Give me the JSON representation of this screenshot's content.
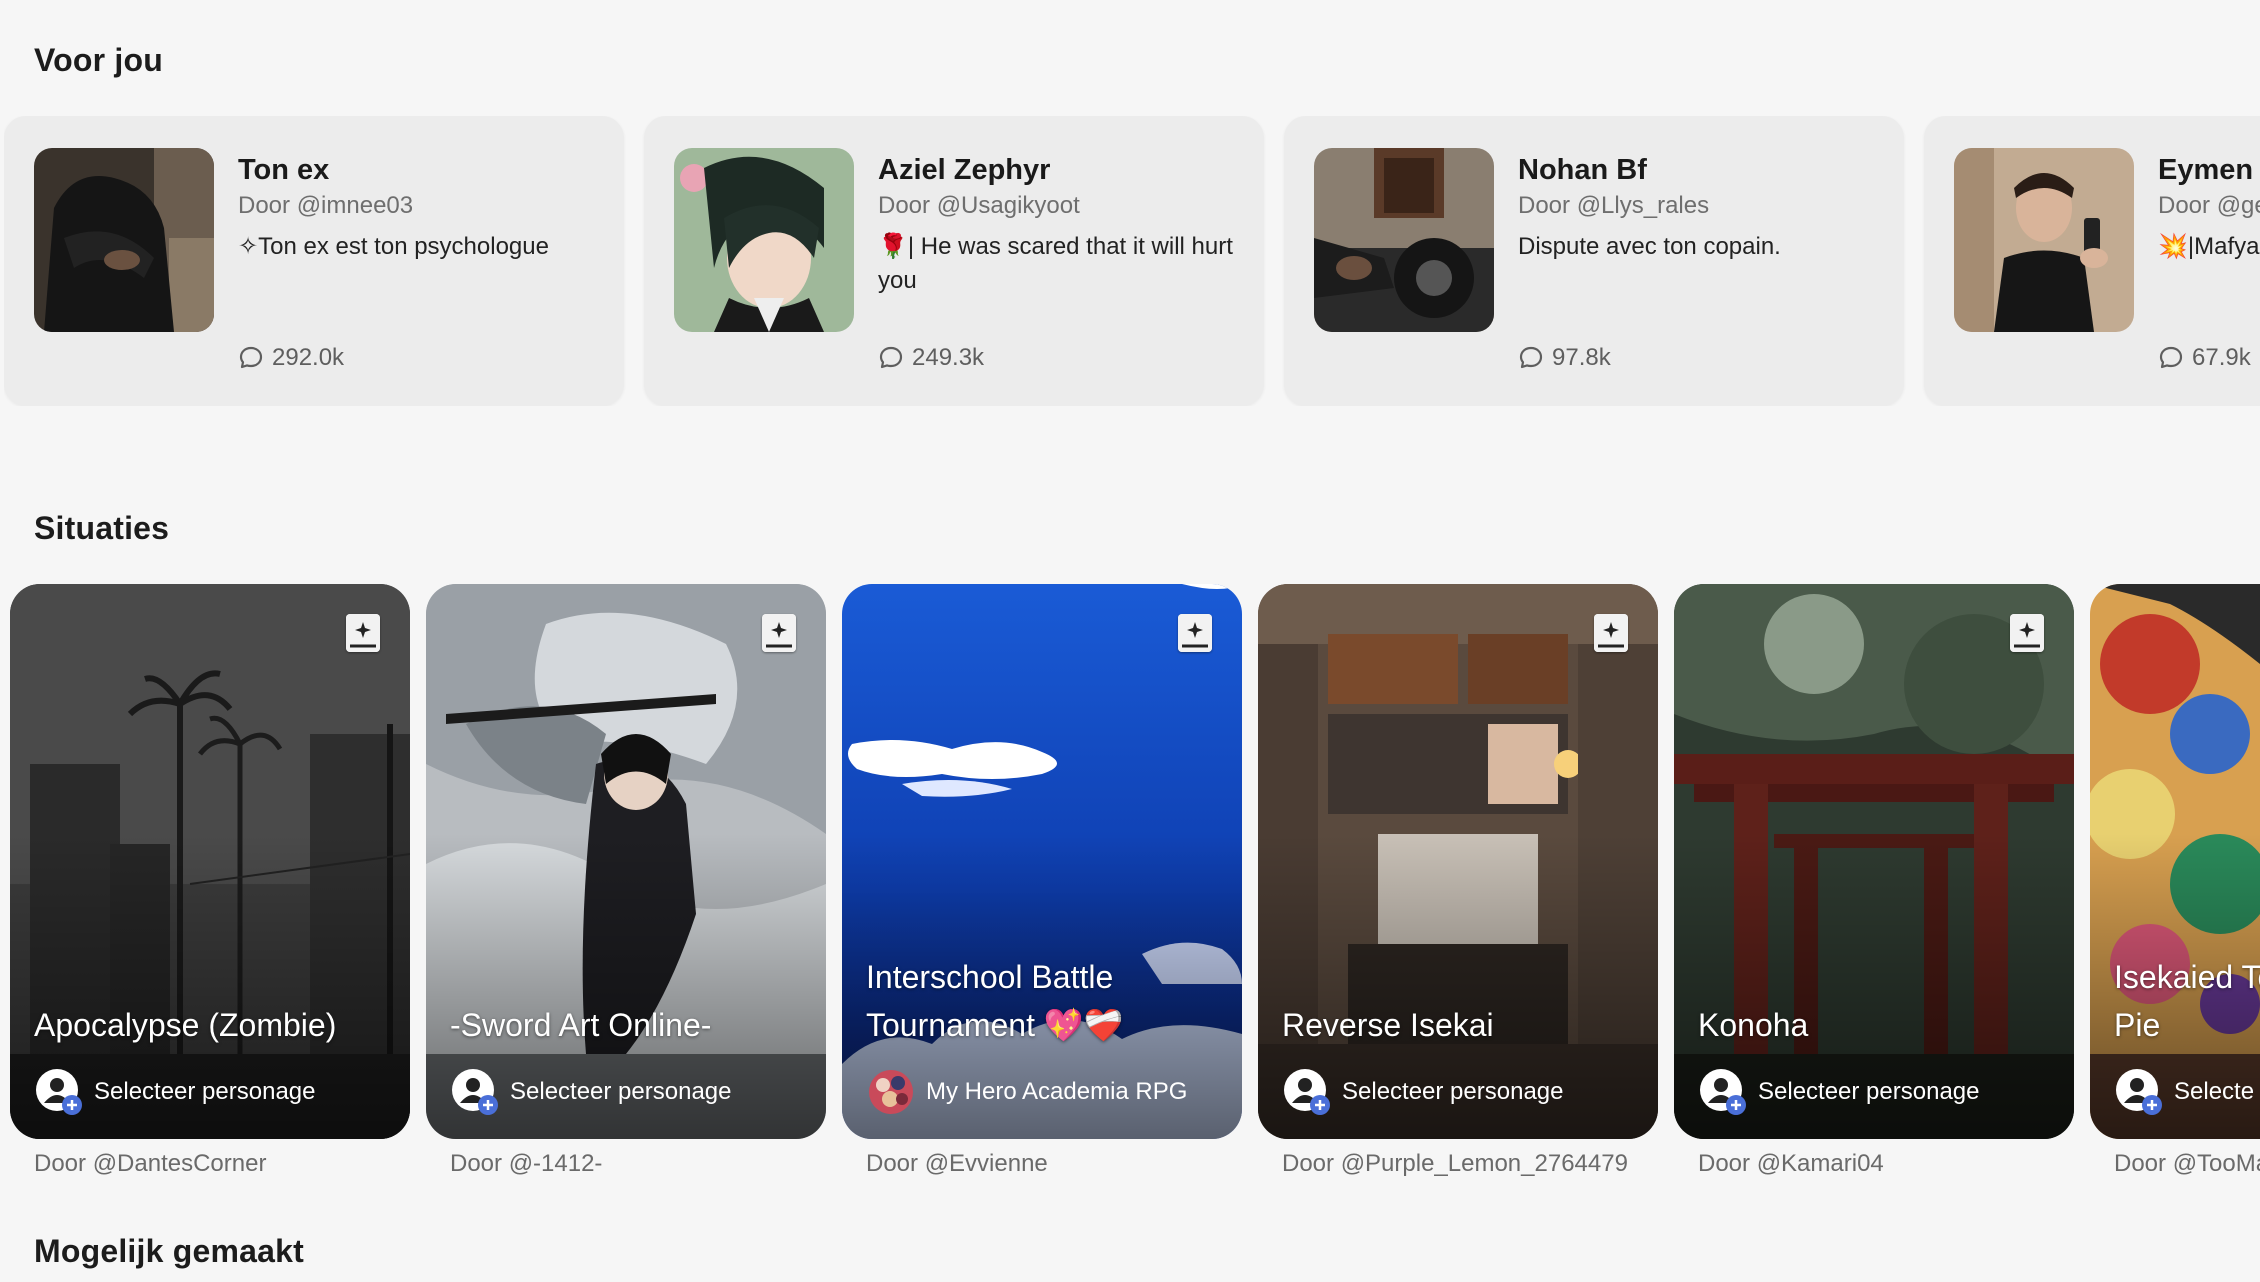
{
  "sections": {
    "for_you": "Voor jou",
    "situations": "Situaties",
    "made_possible": "Mogelijk gemaakt"
  },
  "for_you_cards": [
    {
      "name": "Ton ex",
      "author": "Door @imnee03",
      "description": "✧Ton ex est ton psychologue",
      "chats": "292.0k"
    },
    {
      "name": "Aziel Zephyr",
      "author": "Door @Usagikyoot",
      "description": "🌹| He was scared that it will hurt you",
      "chats": "249.3k"
    },
    {
      "name": "Nohan Bf",
      "author": "Door @Llys_rales",
      "description": "Dispute avec ton copain.",
      "chats": "97.8k"
    },
    {
      "name": "Eymen",
      "author": "Door @ge",
      "description": "💥|Mafya",
      "chats": "67.9k"
    }
  ],
  "situation_cards": [
    {
      "title": "Apocalypse (Zombie)",
      "action": "Selecteer personage",
      "author": "Door @DantesCorner"
    },
    {
      "title": "-Sword Art Online-",
      "action": "Selecteer personage",
      "author": "Door @-1412-"
    },
    {
      "title": "Interschool Battle Tournament 💖❤️‍🩹",
      "action": "My Hero Academia RPG",
      "author": "Door @Evvienne"
    },
    {
      "title": "Reverse Isekai",
      "action": "Selecteer personage",
      "author": "Door @Purple_Lemon_2764479"
    },
    {
      "title": "Konoha",
      "action": "Selecteer personage",
      "author": "Door @Kamari04"
    },
    {
      "title": "Isekaied To Of One Pie",
      "action": "Selecte",
      "author": "Door @TooMa"
    }
  ],
  "colors": {
    "badge_blue": "#4a6fd8",
    "card_bg": "#ececec",
    "page_bg": "#f6f6f6"
  }
}
